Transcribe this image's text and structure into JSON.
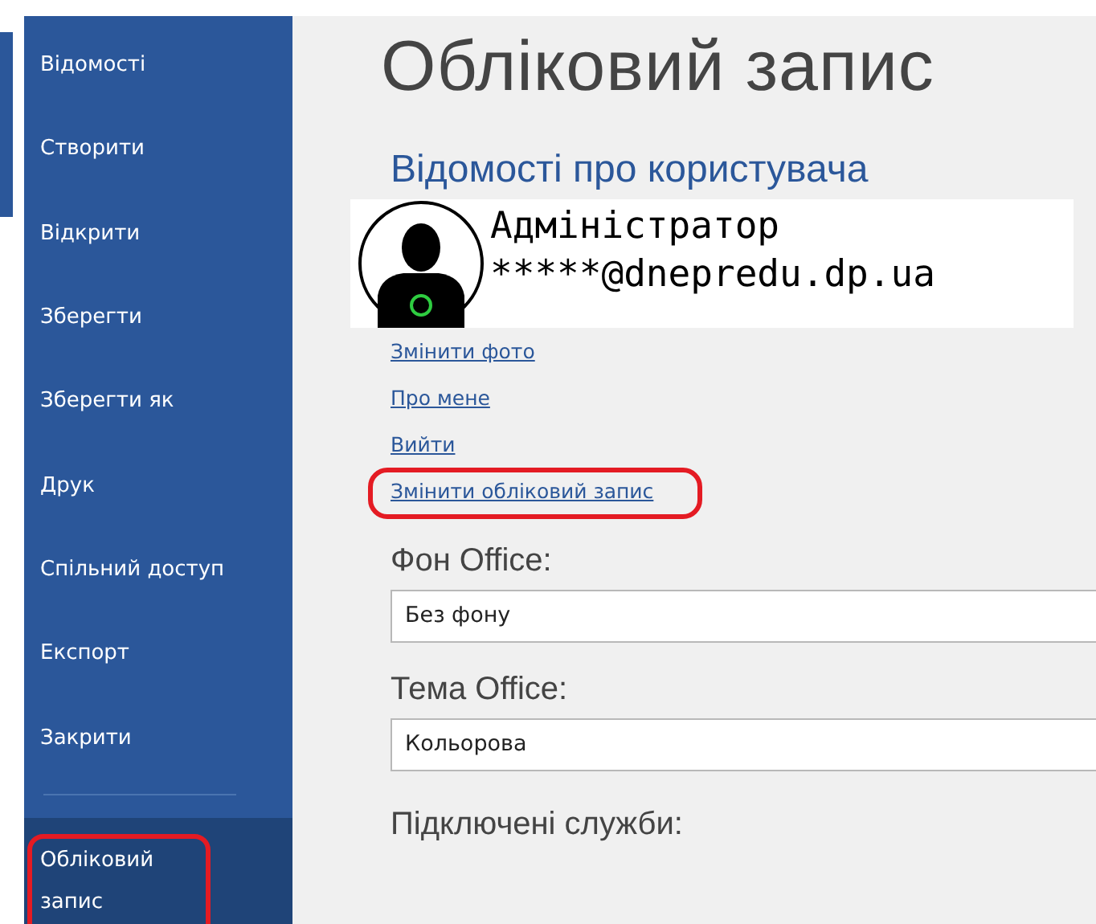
{
  "sidebar": {
    "items": [
      {
        "label": "Відомості",
        "selected": false
      },
      {
        "label": "Створити",
        "selected": false
      },
      {
        "label": "Відкрити",
        "selected": false
      },
      {
        "label": "Зберегти",
        "selected": false
      },
      {
        "label": "Зберегти як",
        "selected": false
      },
      {
        "label": "Друк",
        "selected": false
      },
      {
        "label": "Спільний доступ",
        "selected": false
      },
      {
        "label": "Експорт",
        "selected": false
      },
      {
        "label": "Закрити",
        "selected": false
      }
    ],
    "bottom_items": [
      {
        "label": "Обліковий запис",
        "selected": true,
        "highlighted": true
      }
    ]
  },
  "main": {
    "title": "Обліковий запис",
    "section_title": "Відомості про користувача",
    "user": {
      "name": "Адміністратор",
      "email": "*****@dnepredu.dp.ua"
    },
    "links": [
      {
        "label": "Змінити фото",
        "highlighted": false
      },
      {
        "label": "Про мене",
        "highlighted": false
      },
      {
        "label": "Вийти",
        "highlighted": false
      },
      {
        "label": "Змінити обліковий запис",
        "highlighted": true
      }
    ],
    "settings": [
      {
        "label": "Фон Office:",
        "value": "Без фону"
      },
      {
        "label": "Тема Office:",
        "value": "Кольорова"
      }
    ],
    "services_title": "Підключені служби:"
  }
}
